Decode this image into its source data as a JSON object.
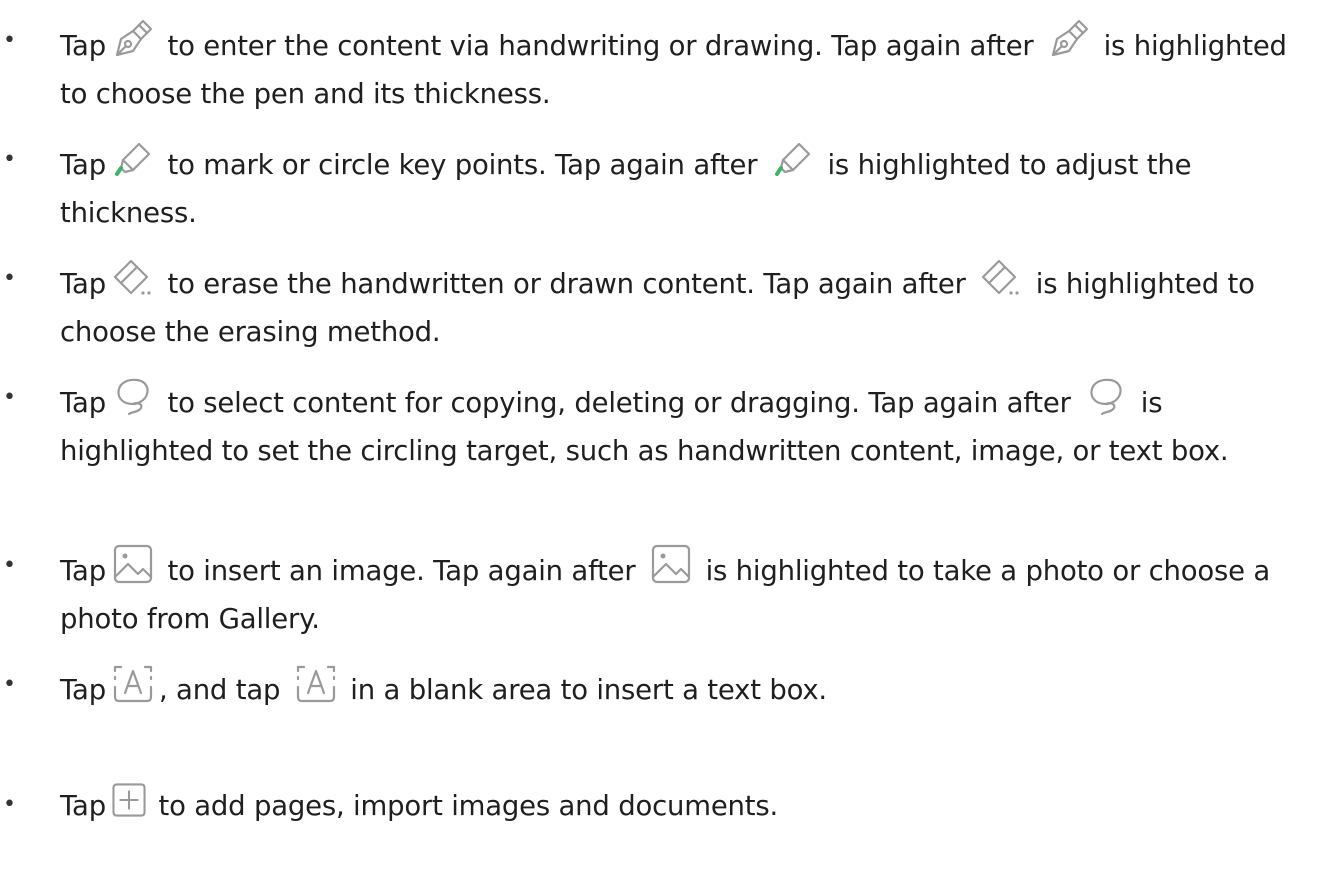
{
  "colors": {
    "text": "#1f1f1f",
    "icon_stroke": "#9a9a9a",
    "accent_green": "#3fb36b"
  },
  "items": [
    {
      "icon": "pen-icon",
      "tap": "Tap",
      "seg1": " to enter the content via handwriting or drawing. Tap again after ",
      "seg2": " is highlighted to choose the pen and its thickness."
    },
    {
      "icon": "highlighter-icon",
      "tap": "Tap",
      "seg1": " to mark or circle key points. Tap again after ",
      "seg2": " is highlighted to adjust the thickness."
    },
    {
      "icon": "eraser-icon",
      "tap": "Tap",
      "seg1": " to erase the handwritten or drawn content. Tap again after ",
      "seg2": " is highlighted to choose the erasing method."
    },
    {
      "icon": "lasso-icon",
      "tap": "Tap",
      "seg1": " to select content for copying, deleting or dragging. Tap again after ",
      "seg2": " is highlighted to set the circling target, such as handwritten content, image, or text box."
    },
    {
      "icon": "image-icon",
      "tap": "Tap",
      "seg1": " to insert an image. Tap again after ",
      "seg2": " is highlighted to take a photo or choose a photo from Gallery."
    },
    {
      "icon": "text-box-icon",
      "tap": "Tap",
      "seg1": ", and tap ",
      "seg2": " in a blank area to insert a text box."
    },
    {
      "icon": "add-icon",
      "tap": "Tap",
      "seg1": " to add pages, import images and documents."
    }
  ]
}
